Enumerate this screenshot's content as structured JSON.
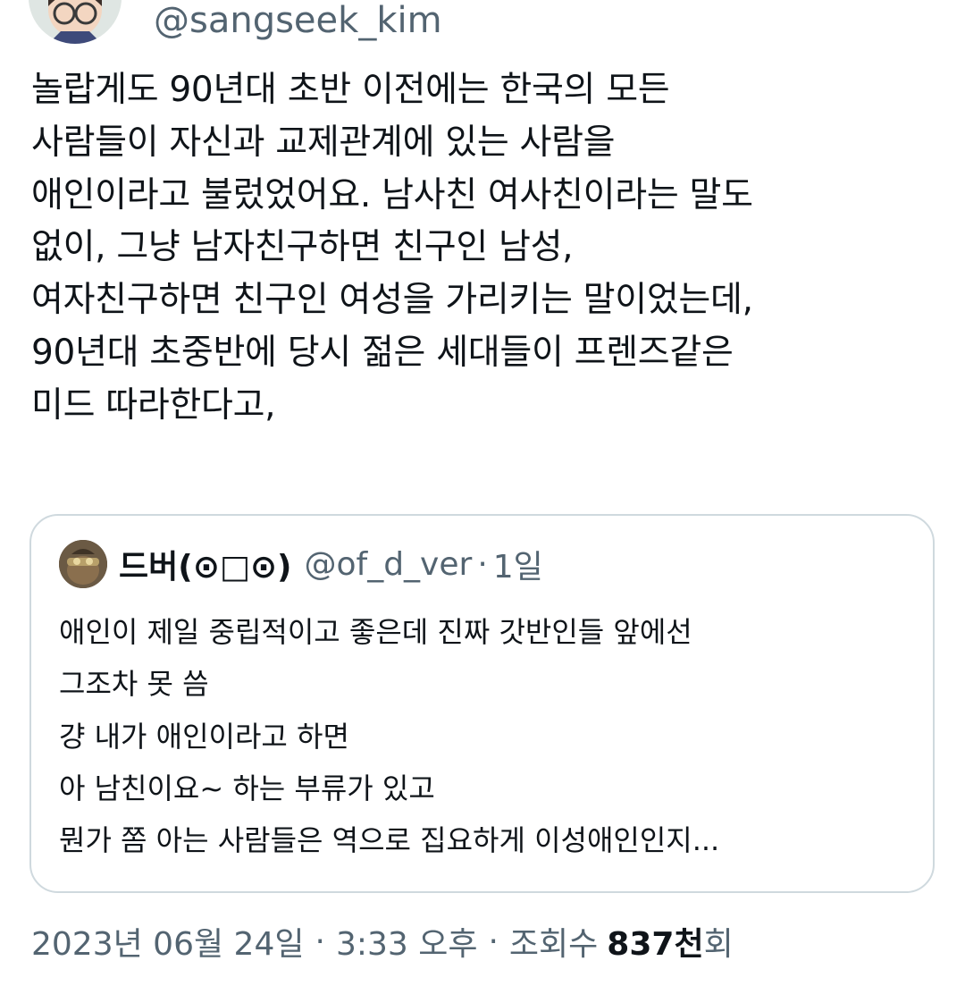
{
  "tweet": {
    "handle": "@sangseek_kim",
    "body_lines": [
      "놀랍게도 90년대 초반 이전에는 한국의 모든",
      "사람들이 자신과 교제관계에 있는 사람을",
      "애인이라고 불렀었어요. 남사친 여사친이라는 말도",
      "없이, 그냥 남자친구하면 친구인 남성,",
      "여자친구하면 친구인 여성을 가리키는 말이었는데,",
      "90년대 초중반에 당시 젊은 세대들이 프렌즈같은",
      "미드 따라한다고,"
    ]
  },
  "quote": {
    "name": "드버(⊙□⊙)",
    "handle": "@of_d_ver",
    "dot": "·",
    "time": "1일",
    "lines": [
      "애인이 제일 중립적이고 좋은데 진짜 갓반인들 앞에선",
      "그조차 못 씀",
      "걍 내가 애인이라고 하면",
      "아 남친이요~ 하는 부류가 있고",
      "뭔가 쫌 아는 사람들은 역으로 집요하게 이성애인인지..."
    ]
  },
  "footer": {
    "date": "2023년 06월 24일",
    "sep1": "·",
    "time": "3:33 오후",
    "sep2": "·",
    "views_label": "조회수",
    "views_count": "837천",
    "views_suffix": "회"
  },
  "colors": {
    "text": "#0f1419",
    "secondary": "#536471",
    "border": "#cfd9de"
  }
}
